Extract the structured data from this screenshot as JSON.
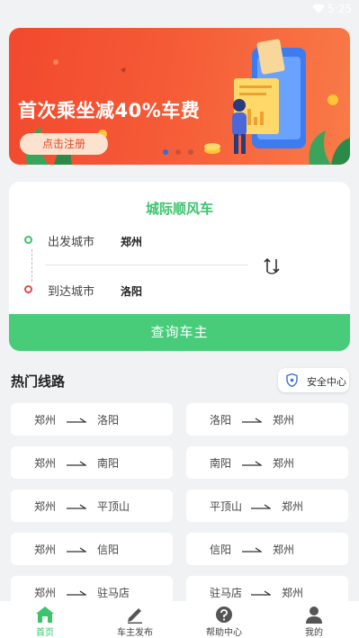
{
  "status": {
    "time": "5:25"
  },
  "banner": {
    "title": "首次乘坐减40%车费",
    "register_label": "点击注册",
    "active_dot": 0,
    "dot_count": 3
  },
  "search": {
    "title": "城际顺风车",
    "from_label": "出发城市",
    "from_value": "郑州",
    "to_label": "到达城市",
    "to_value": "洛阳",
    "query_label": "查询车主"
  },
  "hot": {
    "title": "热门线路",
    "safety_label": "安全中心",
    "routes": [
      {
        "from": "郑州",
        "to": "洛阳"
      },
      {
        "from": "洛阳",
        "to": "郑州"
      },
      {
        "from": "郑州",
        "to": "南阳"
      },
      {
        "from": "南阳",
        "to": "郑州"
      },
      {
        "from": "郑州",
        "to": "平顶山"
      },
      {
        "from": "平顶山",
        "to": "郑州"
      },
      {
        "from": "郑州",
        "to": "信阳"
      },
      {
        "from": "信阳",
        "to": "郑州"
      },
      {
        "from": "郑州",
        "to": "驻马店"
      },
      {
        "from": "驻马店",
        "to": "郑州"
      }
    ]
  },
  "nav": {
    "items": [
      {
        "label": "首页",
        "icon": "home-icon",
        "active": true
      },
      {
        "label": "车主发布",
        "icon": "edit-icon",
        "active": false
      },
      {
        "label": "帮助中心",
        "icon": "help-icon",
        "active": false
      },
      {
        "label": "我的",
        "icon": "user-icon",
        "active": false
      }
    ]
  },
  "colors": {
    "accent": "#48cc7a",
    "banner": "#f2492e",
    "dot_active": "#2f6fe0",
    "to_marker": "#e34b47"
  }
}
